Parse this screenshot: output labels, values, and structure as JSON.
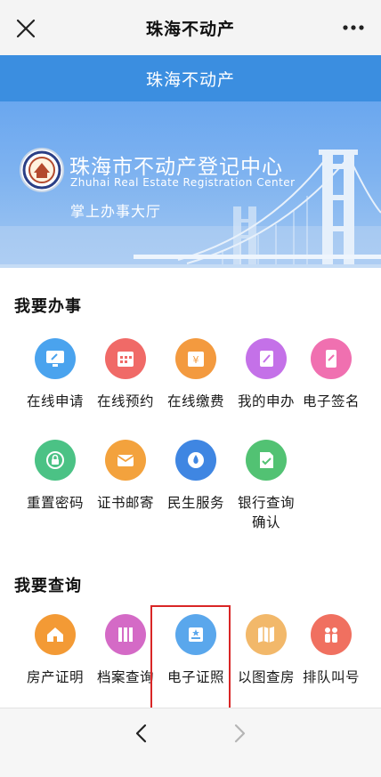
{
  "navbar": {
    "title": "珠海不动产",
    "close_icon": "close-icon",
    "more_icon": "more-icon"
  },
  "header": {
    "title": "珠海不动产"
  },
  "banner": {
    "org_name": "珠海市不动产登记中心",
    "org_name_en": "Zhuhai Real Estate Registration Center",
    "tagline": "掌上办事大厅"
  },
  "sections": {
    "services": {
      "title": "我要办事",
      "items": [
        {
          "label": "在线申请",
          "icon": "monitor-icon",
          "color": "#4aa3ee"
        },
        {
          "label": "在线预约",
          "icon": "calendar-icon",
          "color": "#f06a67"
        },
        {
          "label": "在线缴费",
          "icon": "payment-icon",
          "color": "#f39a3f"
        },
        {
          "label": "我的申办",
          "icon": "notebook-icon",
          "color": "#c471e8"
        },
        {
          "label": "电子签名",
          "icon": "phone-sign-icon",
          "color": "#f070b0"
        },
        {
          "label": "重置密码",
          "icon": "lock-icon",
          "color": "#4bc285"
        },
        {
          "label": "证书邮寄",
          "icon": "mail-icon",
          "color": "#f3a23d"
        },
        {
          "label": "民生服务",
          "icon": "water-drop-icon",
          "color": "#3f86e2"
        },
        {
          "label": "银行查询确认",
          "label_line1": "银行查询",
          "label_line2": "确认",
          "icon": "document-check-icon",
          "color": "#52c273"
        }
      ]
    },
    "queries": {
      "title": "我要查询",
      "items": [
        {
          "label": "房产证明",
          "icon": "house-icon",
          "color": "#f39a35"
        },
        {
          "label": "档案查询",
          "icon": "archive-icon",
          "color": "#d46ac6"
        },
        {
          "label": "电子证照",
          "icon": "e-certificate-icon",
          "color": "#5aa7ec"
        },
        {
          "label": "以图查房",
          "icon": "map-icon",
          "color": "#f2b86a"
        },
        {
          "label": "排队叫号",
          "icon": "queue-icon",
          "color": "#f07060"
        }
      ]
    }
  },
  "highlight": {
    "target": "电子证照",
    "color": "#d92626"
  },
  "toolbar": {
    "back_icon": "chevron-left-icon",
    "forward_icon": "chevron-right-icon"
  }
}
